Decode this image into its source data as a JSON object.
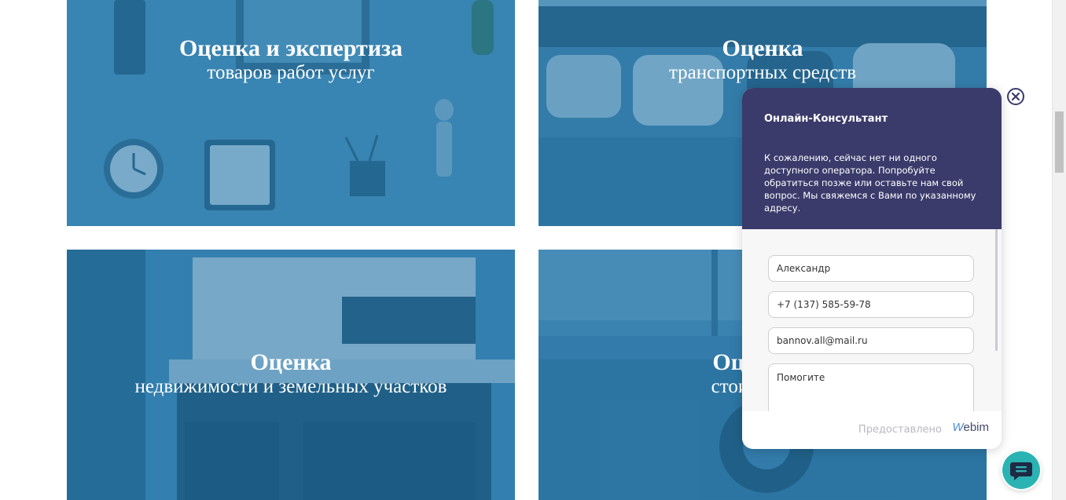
{
  "tiles": [
    {
      "title": "Оценка и экспертиза",
      "subtitle": "товаров работ услуг"
    },
    {
      "title": "Оценка",
      "subtitle": "транспортных средств"
    },
    {
      "title": "Оценка",
      "subtitle": "недвижимости и земельных участков"
    },
    {
      "title": "Оценка р",
      "subtitle": "стоимости р"
    }
  ],
  "chat": {
    "title": "Онлайн-Консультант",
    "message": "К сожалению, сейчас нет ни одного доступного оператора. Попробуйте обратиться позже или оставьте нам свой вопрос. Мы свяжемся с Вами по указанному адресу.",
    "fields": {
      "name": "Александр",
      "phone": "+7 (137) 585-59-78",
      "email": "bannov.all@mail.ru",
      "message": "Помогите"
    },
    "powered_by": "Предоставлено",
    "brand_w": "W",
    "brand_rest": "ebim",
    "close_icon": "close-icon",
    "launcher_icon": "chat-bubble-icon",
    "colors": {
      "header": "#3a3b6b",
      "launcher": "#2bb3b3",
      "tile_overlay": "#1e6ea0"
    }
  }
}
